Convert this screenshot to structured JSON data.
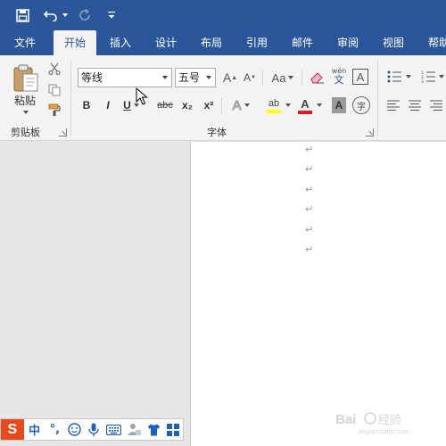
{
  "quick_access": {
    "save": "save-icon",
    "undo": "undo-icon",
    "redo": "redo-icon",
    "customize": "customize-icon"
  },
  "tabs": [
    {
      "label": "文件",
      "active": false
    },
    {
      "label": "开始",
      "active": true
    },
    {
      "label": "插入",
      "active": false
    },
    {
      "label": "设计",
      "active": false
    },
    {
      "label": "布局",
      "active": false
    },
    {
      "label": "引用",
      "active": false
    },
    {
      "label": "邮件",
      "active": false
    },
    {
      "label": "审阅",
      "active": false
    },
    {
      "label": "视图",
      "active": false
    },
    {
      "label": "帮助",
      "active": false
    }
  ],
  "clipboard": {
    "paste_label": "粘贴",
    "group_label": "剪贴板"
  },
  "font": {
    "family": "等线",
    "size": "五号",
    "group_label": "字体",
    "grow": "A",
    "shrink": "A",
    "change_case": "Aa",
    "phonetic_top": "wén",
    "phonetic_bottom": "文",
    "border_char": "A",
    "bold": "B",
    "italic": "I",
    "underline": "U",
    "strikethrough": "abc",
    "subscript": "x₂",
    "superscript": "x²",
    "effects": "A",
    "highlight": "ab",
    "font_color": "A",
    "shading": "A",
    "enclose": "字",
    "highlight_color": "#ffff00",
    "font_color_value": "#d71c1c"
  },
  "document": {
    "paragraph_mark": "↵",
    "paragraph_count": 6
  },
  "ime": {
    "logo": "S",
    "mode": "中",
    "punct": "°,",
    "emoji": "emoji-icon",
    "voice": "microphone-icon",
    "keyboard": "keyboard-icon",
    "user": "user-icon",
    "skin": "shirt-icon",
    "tools": "grid-icon"
  },
  "watermark": "Baidu 经验 jingyan.baidu.com"
}
